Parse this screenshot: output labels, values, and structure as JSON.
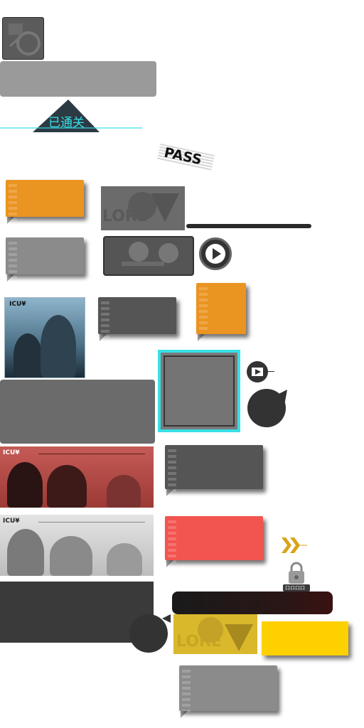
{
  "cleared": {
    "label": "已通关"
  },
  "pass": {
    "label": "PASS"
  },
  "card_brand": {
    "label_1": "ICU¥",
    "label_2": "ICU¥",
    "label_3": "ICU¥"
  },
  "banner_text": {
    "top": "LORE",
    "bottom": "LORE"
  },
  "lock_label": "口ロ口口",
  "colors": {
    "orange": "#ea9421",
    "cyan": "#37e0e6",
    "red": "#f2544f",
    "yellow": "#ffd000",
    "dark": "#3a3a3a",
    "gray": "#8b8b8b"
  }
}
